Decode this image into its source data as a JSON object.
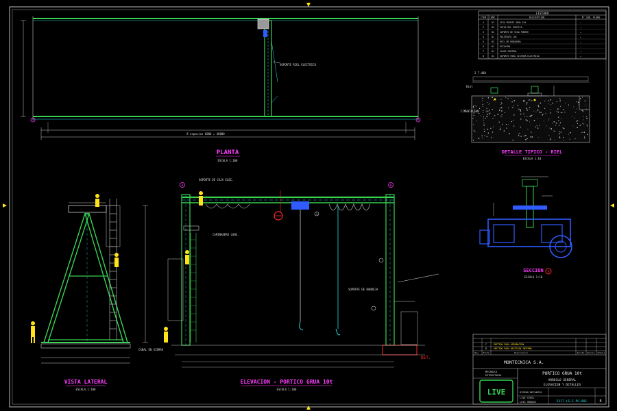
{
  "colors": {
    "background": "#000000",
    "frame": "#cfcfcf",
    "magenta": "#ff3cff",
    "green": "#39d353",
    "cyan": "#22e0e0",
    "yellow": "#ffe21a",
    "blue": "#2f5bff",
    "red": "#ff2a2a"
  },
  "views": {
    "planta": {
      "title": "PLANTA",
      "scale": "ESCALA 1:100"
    },
    "vista_lateral": {
      "title": "VISTA LATERAL",
      "scale": "ESCALA 1:100"
    },
    "elevacion": {
      "title": "ELEVACION - PORTICO GRUA 10t",
      "scale": "ESCALA 1:100"
    },
    "detalle_riel": {
      "title": "DETALLE TIPICO - RIEL",
      "scale": "ESCALA 1:10"
    },
    "seccion": {
      "title": "SECCION",
      "marker": "X",
      "scale": "ESCALA 1:10"
    }
  },
  "annotations": {
    "plan_support": "SOPORTE RIEL ELECTRICO",
    "plan_dimension": "8 espacios 6000 = 48000",
    "elev_support": "SOPORTE DE CAJA ELEC.",
    "elev_platform": "CAMINADERO LONG.",
    "elev_cable": "SOPORTE DE BANDEJA",
    "lateral_rail": "CANAL EN SIERRO",
    "elev_right": "DET.",
    "det_cimentacion": "CIMENTACION",
    "det_dim": "2 7.400",
    "det_rail": "Riel"
  },
  "parts_table": {
    "title": "LISTADO",
    "headers": [
      "ITEM",
      "CANT.",
      "DESCRIPCION",
      "N° SUB. PLANO"
    ],
    "rows": [
      [
        "1",
        "01",
        "VIGA PUENTE GRUA 10t",
        "—"
      ],
      [
        "2",
        "02",
        "PATAS DEL PORTICO",
        "—"
      ],
      [
        "3",
        "02",
        "SOPORTE DE VIGA PUENTE",
        "—"
      ],
      [
        "4",
        "01",
        "POLIPASTO 10t",
        "—"
      ],
      [
        "5",
        "02",
        "RIEL DE RODADURA",
        "—"
      ],
      [
        "6",
        "01",
        "ESCALERA",
        "—"
      ],
      [
        "7",
        "01",
        "CAJAS CONTROL",
        "—"
      ],
      [
        "8",
        "01",
        "SOPORTE PARA SISTEMA ELECTRICO",
        "—"
      ]
    ]
  },
  "revisions": {
    "rows": [
      [
        "C",
        "",
        "EMITIDO PARA APROBACION",
        "",
        ""
      ],
      [
        "B",
        "",
        "EMITIDO PARA REVISION INTERNA",
        "",
        ""
      ]
    ],
    "headers": [
      "Rev.",
      "Fecha",
      "Descripción",
      "Aprobó",
      "Revisó",
      "Dibujó"
    ]
  },
  "title_block": {
    "company": "MONTECNICA S.A.",
    "project": "PORTICO GRUA 10t",
    "subtitle_1": "ARREGLO GENERAL",
    "subtitle_2": "ELEVACION Y DETALLES",
    "logo_text": "LIVE",
    "drawing_number": "5117-LS-E-PG-001",
    "revision": "B",
    "left_labels": [
      "MECANICA",
      "ESTRUCTURAL"
    ],
    "meta": [
      "DISEÑO MECANICO",
      "LIVE STEEL",
      "LUIS GRADOS"
    ]
  },
  "markers": {
    "a": "A",
    "b": "B",
    "c": "1"
  }
}
